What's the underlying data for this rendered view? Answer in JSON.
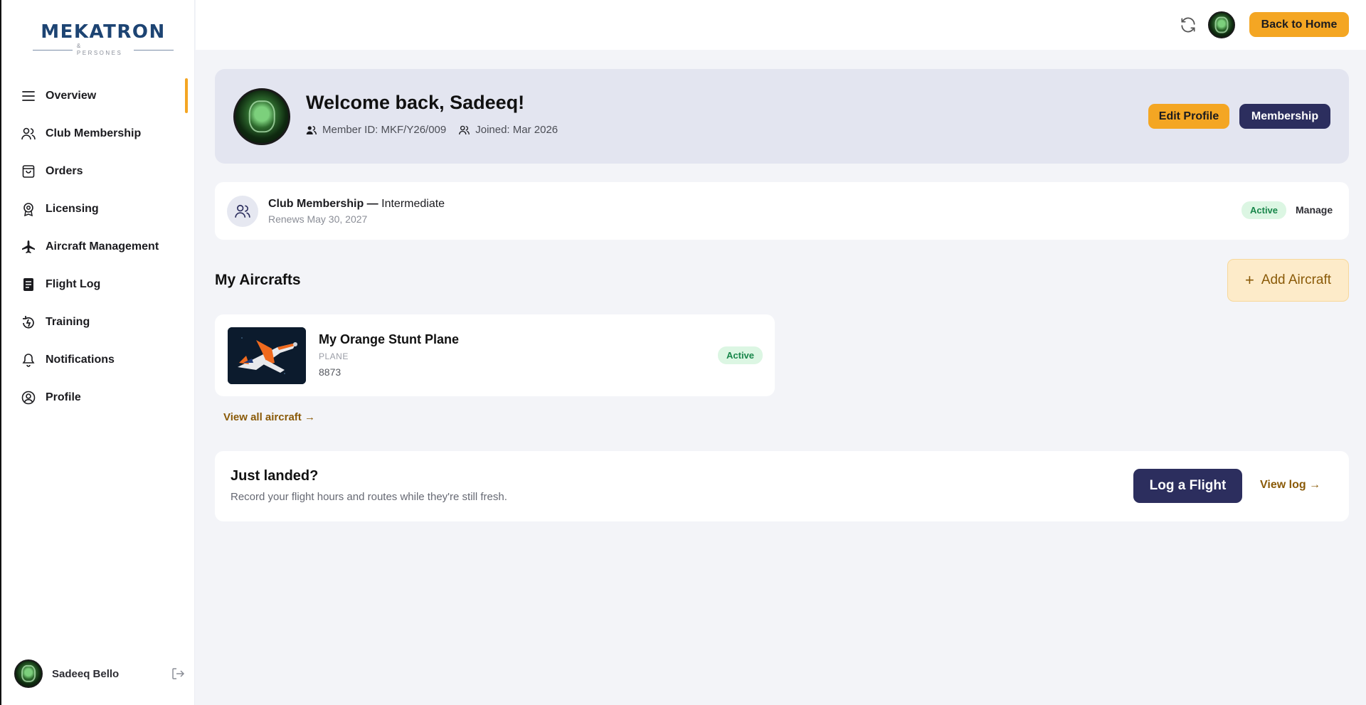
{
  "brand": {
    "logo_main": "MEKATRON",
    "logo_sub": "& PERSONES"
  },
  "colors": {
    "accent": "#f4a623",
    "navy": "#2c2e5e",
    "success_bg": "#dcf6e3",
    "success_text": "#18864a"
  },
  "sidebar": {
    "items": [
      {
        "label": "Overview",
        "icon": "menu-icon"
      },
      {
        "label": "Club Membership",
        "icon": "users-icon"
      },
      {
        "label": "Orders",
        "icon": "shopping-bag-icon"
      },
      {
        "label": "Licensing",
        "icon": "badge-icon"
      },
      {
        "label": "Aircraft Management",
        "icon": "plane-icon"
      },
      {
        "label": "Flight Log",
        "icon": "document-icon"
      },
      {
        "label": "Training",
        "icon": "training-icon"
      },
      {
        "label": "Notifications",
        "icon": "bell-icon"
      },
      {
        "label": "Profile",
        "icon": "user-circle-icon"
      }
    ],
    "user": {
      "name": "Sadeeq Bello"
    }
  },
  "topbar": {
    "home_label": "Back to Home"
  },
  "welcome": {
    "title": "Welcome back, Sadeeq!",
    "member_id": "Member ID: MKF/Y26/009",
    "joined": "Joined: Mar 2026",
    "edit_label": "Edit Profile",
    "membership_label": "Membership"
  },
  "membership_strip": {
    "title_prefix": "Club Membership —",
    "tier": "Intermediate",
    "renews": "Renews May 30, 2027",
    "status": "Active",
    "manage_label": "Manage"
  },
  "aircrafts": {
    "section_title": "My Aircrafts",
    "add_label": "Add Aircraft",
    "items": [
      {
        "name": "My Orange Stunt Plane",
        "type": "PLANE",
        "number": "8873",
        "status": "Active"
      }
    ],
    "view_all": "View all aircraft →"
  },
  "landed": {
    "title": "Just landed?",
    "subtitle": "Record your flight hours and routes while they're still fresh.",
    "log_label": "Log a Flight",
    "view_log": "View log →"
  }
}
